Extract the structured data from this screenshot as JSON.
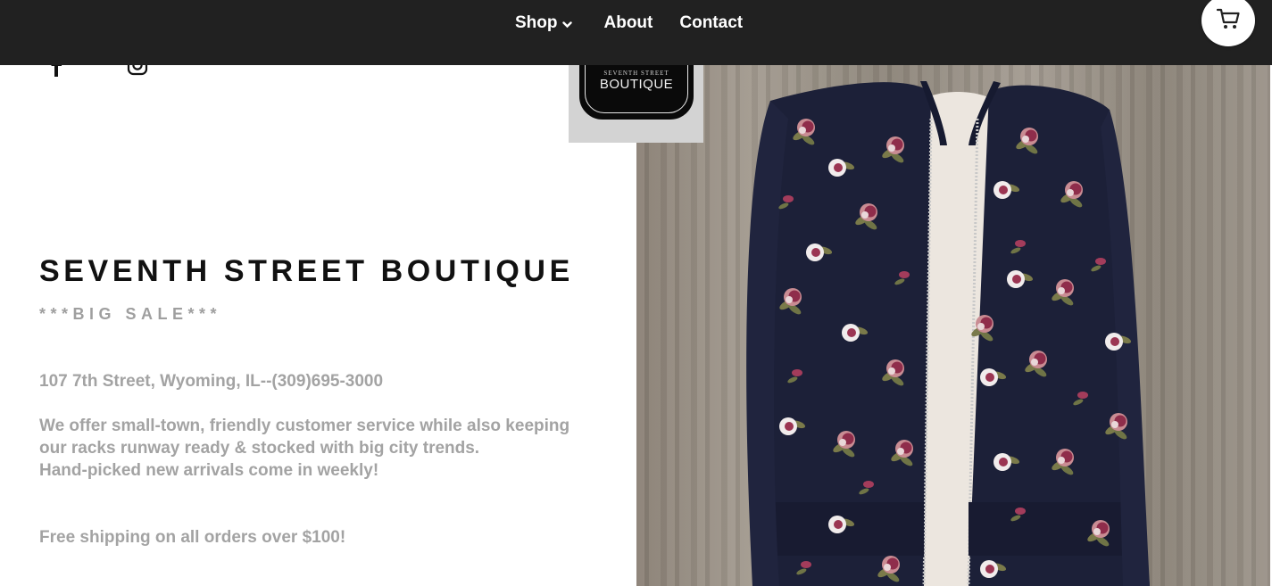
{
  "nav": {
    "links": [
      {
        "label": "Shop",
        "has_dropdown": true
      },
      {
        "label": "About"
      },
      {
        "label": "Contact"
      }
    ],
    "cart_icon": "shopping-cart-icon"
  },
  "social": {
    "icons": [
      "facebook-icon",
      "instagram-icon"
    ]
  },
  "logo": {
    "line1": "SEVENTH STREET",
    "line2": "BOUTIQUE"
  },
  "hero": {
    "title": "SEVENTH STREET BOUTIQUE",
    "subtitle": "***BIG SALE***",
    "address": "107 7th Street, Wyoming, IL--(309)695-3000",
    "description_lines": [
      "We offer small-town, friendly customer service while also keeping",
      "our racks runway ready & stocked with big city trends.",
      "Hand-picked new arrivals come in weekly!"
    ],
    "shipping": "Free shipping on all orders over $100!"
  },
  "colors": {
    "nav_bg": "#212121",
    "title": "#111111",
    "muted_text": "#a3a3a3",
    "logo_tile": "#d3d3d3"
  }
}
